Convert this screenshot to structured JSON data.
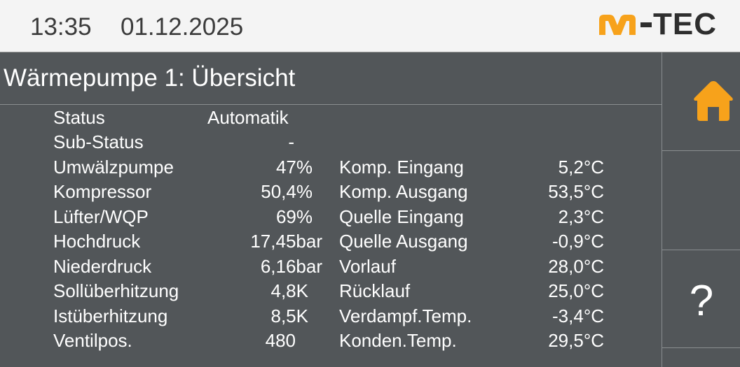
{
  "header": {
    "time": "13:35",
    "date": "01.12.2025",
    "logo_text": "M-TEC",
    "logo_accent_color": "#f7a21b"
  },
  "page": {
    "title": "Wärmepumpe 1: Übersicht"
  },
  "sidebar": {
    "home_icon": "home-icon",
    "help_label": "?"
  },
  "status": {
    "status_label": "Status",
    "status_value": "Automatik",
    "substatus_label": "Sub-Status",
    "substatus_value": "-"
  },
  "left": [
    {
      "label": "Umwälzpumpe",
      "value": "47%"
    },
    {
      "label": "Kompressor",
      "value": "50,4%"
    },
    {
      "label": "Lüfter/WQP",
      "value": "69%"
    },
    {
      "label": "Hochdruck",
      "value": "17,45bar"
    },
    {
      "label": "Niederdruck",
      "value": "6,16bar"
    },
    {
      "label": "Sollüberhitzung",
      "value": "4,8K"
    },
    {
      "label": "Istüberhitzung",
      "value": "8,5K"
    },
    {
      "label": "Ventilpos.",
      "value": "480"
    }
  ],
  "right": [
    {
      "label": "Komp. Eingang",
      "value": "5,2°C"
    },
    {
      "label": "Komp. Ausgang",
      "value": "53,5°C"
    },
    {
      "label": "Quelle Eingang",
      "value": "2,3°C"
    },
    {
      "label": "Quelle Ausgang",
      "value": "-0,9°C"
    },
    {
      "label": "Vorlauf",
      "value": "28,0°C"
    },
    {
      "label": "Rücklauf",
      "value": "25,0°C"
    },
    {
      "label": "Verdampf.Temp.",
      "value": "-3,4°C"
    },
    {
      "label": "Konden.Temp.",
      "value": "29,5°C"
    }
  ]
}
